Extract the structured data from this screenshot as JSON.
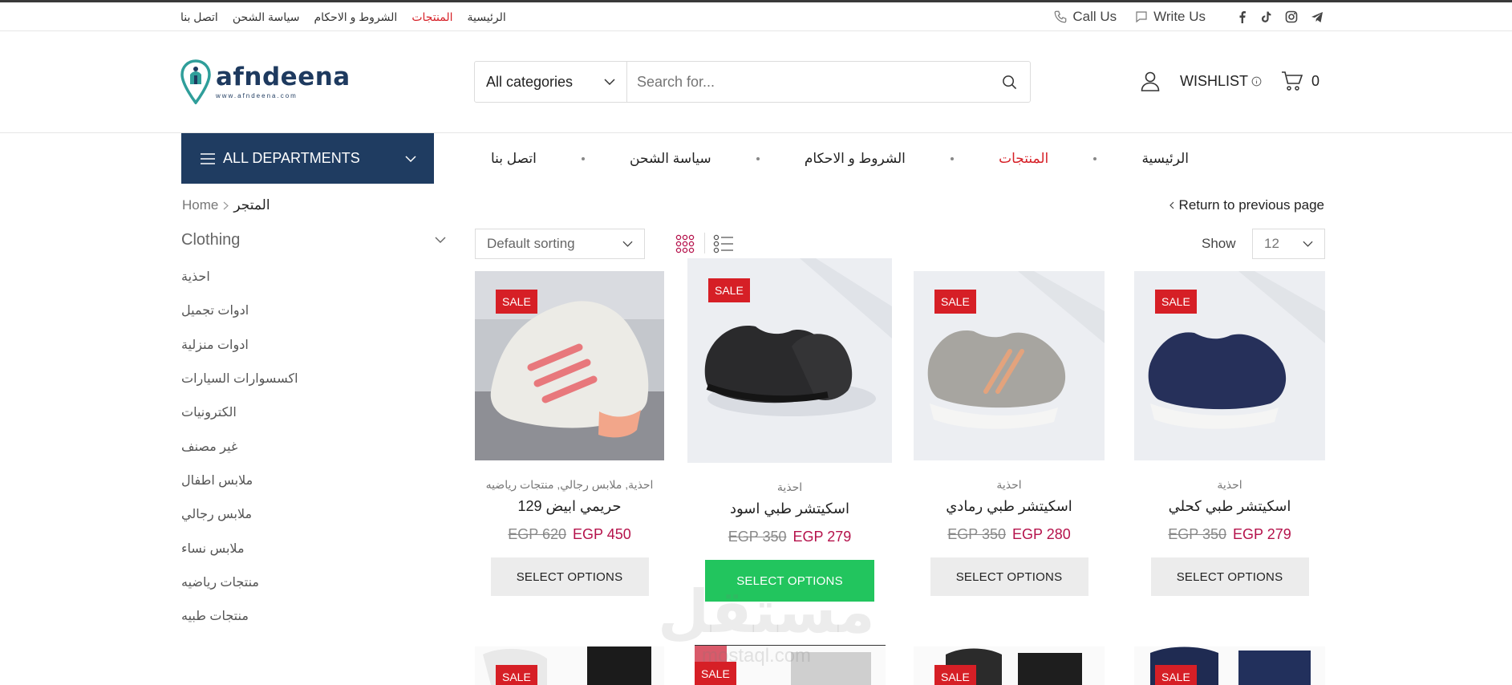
{
  "topbar": {
    "links": [
      {
        "label": "الرئيسية",
        "active": false
      },
      {
        "label": "المنتجات",
        "active": true
      },
      {
        "label": "الشروط و الاحكام",
        "active": false
      },
      {
        "label": "سياسة الشحن",
        "active": false
      },
      {
        "label": "اتصل بنا",
        "active": false
      }
    ],
    "call_label": "Call Us",
    "write_label": "Write Us",
    "social_icons": [
      "facebook-icon",
      "tiktok-icon",
      "instagram-icon",
      "telegram-icon"
    ]
  },
  "header": {
    "logo_text": "afndeena",
    "logo_sub": "www.afndeena.com",
    "category_select": "All categories",
    "search_placeholder": "Search for...",
    "wishlist_label": "WISHLIST",
    "cart_count": "0"
  },
  "nav": {
    "departments_label": "ALL DEPARTMENTS",
    "items": [
      {
        "label": "الرئيسية",
        "active": false
      },
      {
        "label": "المنتجات",
        "active": true
      },
      {
        "label": "الشروط و الاحكام",
        "active": false
      },
      {
        "label": "سياسة الشحن",
        "active": false
      },
      {
        "label": "اتصل بنا",
        "active": false
      }
    ]
  },
  "breadcrumb": {
    "home": "Home",
    "current": "المتجر"
  },
  "return_label": "Return to previous page",
  "sidebar": {
    "heading": "Clothing",
    "categories": [
      "احذية",
      "ادوات تجميل",
      "ادوات منزلية",
      "اكسسوارات السيارات",
      "الكترونيات",
      "غير مصنف",
      "ملابس اطفال",
      "ملابس رجالي",
      "ملابس نساء",
      "منتجات رياضيه",
      "منتجات طبيه"
    ]
  },
  "toolbar": {
    "sort_label": "Default sorting",
    "show_label": "Show",
    "show_value": "12"
  },
  "products": [
    {
      "badge": "SALE",
      "category": "احذية, ملابس رجالي, منتجات رياضيه",
      "name": "حريمي ابيض 129",
      "old_price": "EGP 620",
      "new_price": "EGP 450",
      "button": "SELECT OPTIONS",
      "shoe_color": "#e8e6df",
      "accent": "#e8787c",
      "bg": "#c9ccd0"
    },
    {
      "badge": "SALE",
      "category": "احذية",
      "name": "اسكيتشر طبي اسود",
      "old_price": "EGP 350",
      "new_price": "EGP 279",
      "button": "SELECT OPTIONS",
      "shoe_color": "#2a2a2c",
      "accent": "#2a2a2c",
      "bg": "#eceef2"
    },
    {
      "badge": "SALE",
      "category": "احذية",
      "name": "اسكيتشر طبي رمادي",
      "old_price": "EGP 350",
      "new_price": "EGP 280",
      "button": "SELECT OPTIONS",
      "shoe_color": "#a7a5a0",
      "accent": "#e3a37d",
      "bg": "#eceef2"
    },
    {
      "badge": "SALE",
      "category": "احذية",
      "name": "اسكيتشر طبي كحلي",
      "old_price": "EGP 350",
      "new_price": "EGP 279",
      "button": "SELECT OPTIONS",
      "shoe_color": "#26305a",
      "accent": "#26305a",
      "bg": "#eceef2"
    }
  ],
  "row2_badges": [
    "SALE",
    "SALE",
    "SALE",
    "SALE"
  ],
  "watermark": {
    "text": "مستقل",
    "sub": "mostaql.com"
  },
  "colors": {
    "brand_navy": "#1f3c61",
    "sale_red": "#d61f26",
    "price": "#b5124b",
    "hover_green": "#22c55e"
  }
}
